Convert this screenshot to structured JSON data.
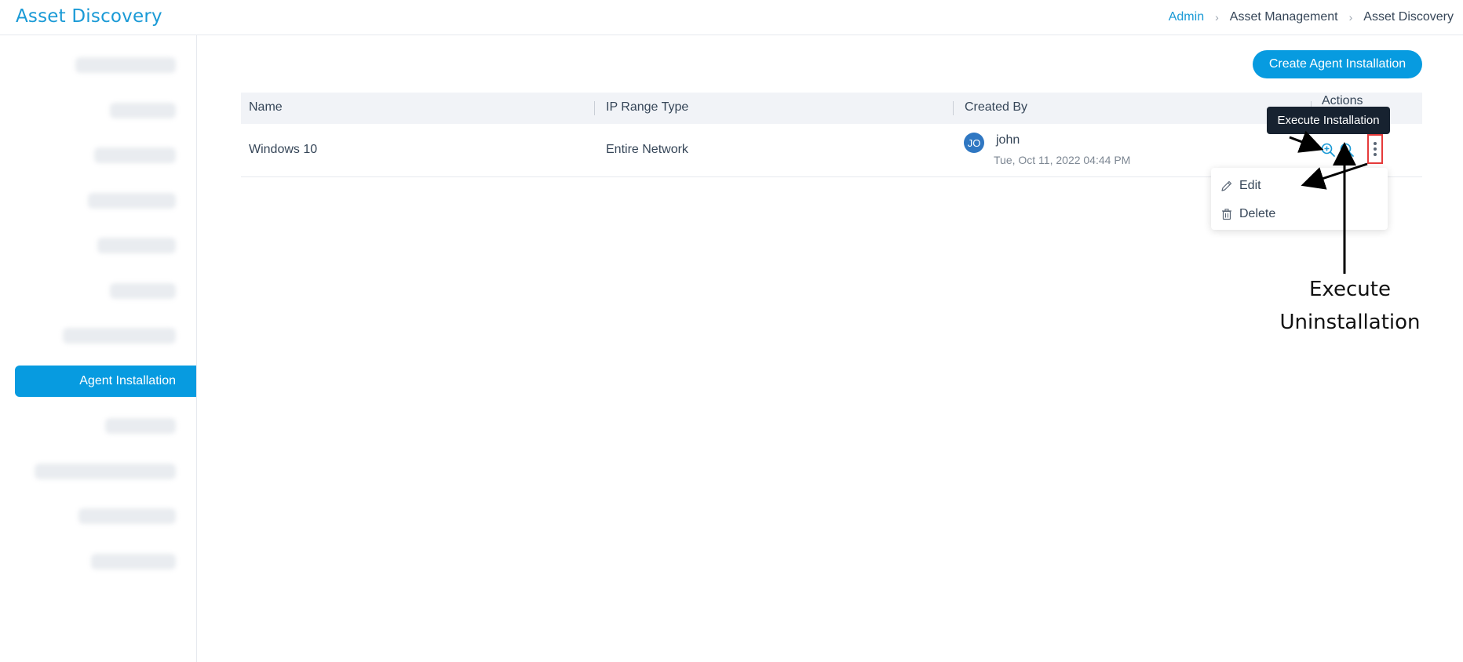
{
  "header": {
    "title": "Asset Discovery",
    "breadcrumb": [
      {
        "label": "Admin",
        "link": true
      },
      {
        "label": "Asset Management",
        "link": false
      },
      {
        "label": "Asset Discovery",
        "link": false
      }
    ]
  },
  "sidebar": {
    "active_label": "Agent Installation"
  },
  "toolbar": {
    "create_label": "Create Agent Installation"
  },
  "table": {
    "headers": {
      "name": "Name",
      "ip_range_type": "IP Range Type",
      "created_by": "Created By",
      "actions": "Actions"
    },
    "rows": [
      {
        "name": "Windows 10",
        "ip_range_type": "Entire Network",
        "avatar_initials": "JO",
        "created_by": "john",
        "created_on": "Tue, Oct 11, 2022 04:44 PM"
      }
    ]
  },
  "tooltip": {
    "text": "Execute Installation"
  },
  "row_menu": {
    "items": [
      "Edit",
      "Delete"
    ]
  },
  "annotation": {
    "line1": "Execute",
    "line2": "Uninstallation"
  },
  "colors": {
    "brand": "#079be0",
    "title": "#1a9ad6",
    "highlight": "#e63b3b",
    "tooltip_bg": "#172230"
  },
  "icons": [
    "chevron-right-icon",
    "zoom-in-icon",
    "zoom-out-icon",
    "kebab-menu-icon",
    "pencil-icon",
    "trash-icon"
  ]
}
